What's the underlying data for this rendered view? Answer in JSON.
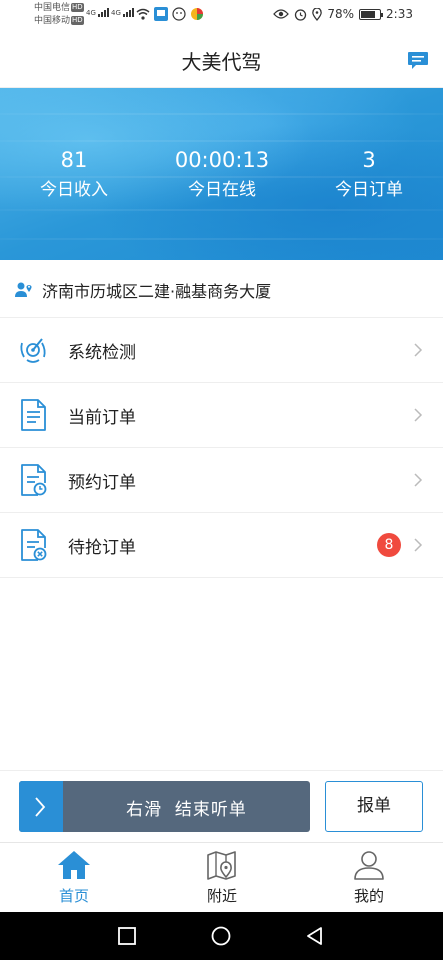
{
  "status_bar": {
    "carrier1": "中国电信",
    "carrier2": "中国移动",
    "hd": "HD",
    "network": "4G",
    "battery_percent": "78%",
    "battery_level": 0.78,
    "time": "2:33"
  },
  "header": {
    "title": "大美代驾",
    "message_icon": "chat-bubble-icon"
  },
  "stats": [
    {
      "value": "81",
      "label": "今日收入"
    },
    {
      "value": "00:00:13",
      "label": "今日在线"
    },
    {
      "value": "3",
      "label": "今日订单"
    }
  ],
  "location": {
    "text": "济南市历城区二建·融基商务大厦",
    "icon": "location-person-icon"
  },
  "menu": [
    {
      "label": "系统检测",
      "icon": "radar-icon"
    },
    {
      "label": "当前订单",
      "icon": "document-icon"
    },
    {
      "label": "预约订单",
      "icon": "document-clock-icon"
    },
    {
      "label": "待抢订单",
      "icon": "document-x-icon",
      "badge": "8"
    }
  ],
  "action": {
    "slider_text": "右滑  结束听单",
    "report_label": "报单"
  },
  "tabs": [
    {
      "label": "首页",
      "icon": "home-icon",
      "active": true
    },
    {
      "label": "附近",
      "icon": "map-pin-icon",
      "active": false
    },
    {
      "label": "我的",
      "icon": "person-icon",
      "active": false
    }
  ],
  "colors": {
    "accent": "#2a8fd6",
    "badge": "#f04a3e",
    "slider": "#55687d"
  }
}
